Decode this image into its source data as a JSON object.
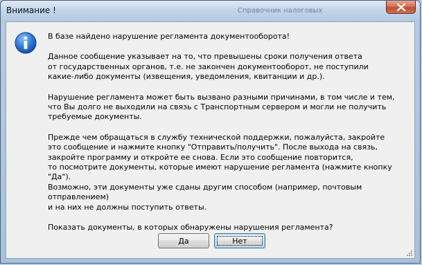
{
  "window": {
    "title": "Внимание !",
    "background_title": "Справочник налоговых"
  },
  "message": {
    "paragraphs": [
      "В базе найдено нарушение регламента документооборота!",
      "Данное сообщение указывает на то, что превышены сроки получения ответа\nот государственных органов, т.е. не закончен документооборот, не поступили\nкакие-либо документы (извещения, уведомления, квитанции и др.).",
      "Нарушение регламента может быть вызвано разными причинами, в том числе и тем,\nчто Вы долго не выходили на связь с Транспортным сервером и могли не получить\nтребуемые документы.",
      "Прежде чем обращаться в службу технической поддержки, пожалуйста, закройте\nэто сообщение и нажмите кнопку \"Отправить/получить\". После выхода на связь,\nзакройте программу и откройте ее снова. Если это сообщение повторится,\nто посмотрите документы, которые имеют нарушение регламента (нажмите кнопку \"Да\").\nВозможно, эти документы уже сданы другим способом (например, почтовым отправлением)\nи на них не должны поступить ответы.",
      "Показать документы, в которых обнаружены нарушения регламента?"
    ]
  },
  "buttons": {
    "yes": "Да",
    "no": "Нет"
  },
  "icons": {
    "dialog_icon": "info-icon",
    "close": "close-icon"
  },
  "colors": {
    "close_button": "#c24d33",
    "info_icon": "#1d5fbf",
    "dialog_background": "#f0f0f0"
  }
}
